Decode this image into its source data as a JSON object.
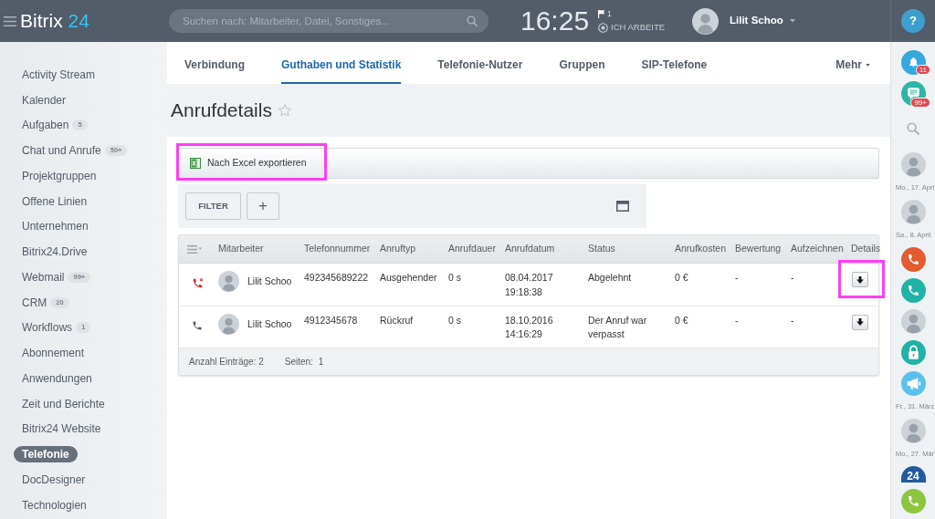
{
  "header": {
    "logo": {
      "name": "Bitrix",
      "number": "24"
    },
    "search": {
      "placeholder": "Suchen nach: Mitarbeiter, Datei, Sonstiges..."
    },
    "clock": "16:25",
    "flag_count": "1",
    "work_status": "ICH ARBEITE",
    "user": {
      "name": "Lilit Schoo"
    }
  },
  "sidebar": {
    "items": [
      {
        "label": "Activity Stream",
        "selected": false
      },
      {
        "label": "Kalender",
        "selected": false
      },
      {
        "label": "Aufgaben",
        "counter": "5",
        "selected": false
      },
      {
        "label": "Chat und Anrufe",
        "counter": "50+",
        "selected": false
      },
      {
        "label": "Projektgruppen",
        "selected": false
      },
      {
        "label": "Offene Linien",
        "selected": false
      },
      {
        "label": "Unternehmen",
        "selected": false
      },
      {
        "label": "Bitrix24.Drive",
        "selected": false
      },
      {
        "label": "Webmail",
        "counter": "99+",
        "selected": false
      },
      {
        "label": "CRM",
        "counter": "20",
        "selected": false
      },
      {
        "label": "Workflows",
        "counter": "1",
        "selected": false
      },
      {
        "label": "Abonnement",
        "selected": false
      },
      {
        "label": "Anwendungen",
        "selected": false
      },
      {
        "label": "Zeit und Berichte",
        "selected": false
      },
      {
        "label": "Bitrix24 Website",
        "selected": false
      },
      {
        "label": "Telefonie",
        "selected": true
      },
      {
        "label": "DocDesigner",
        "selected": false
      },
      {
        "label": "Technologien",
        "selected": false
      }
    ]
  },
  "tab_bar": {
    "tabs": [
      {
        "label": "Verbindung",
        "selected": false
      },
      {
        "label": "Guthaben und Statistik",
        "selected": true
      },
      {
        "label": "Telefonie-Nutzer",
        "selected": false
      },
      {
        "label": "Gruppen",
        "selected": false
      },
      {
        "label": "SIP-Telefone",
        "selected": false
      }
    ],
    "more": "Mehr"
  },
  "page_title": "Anrufdetails",
  "export_button": {
    "label": "Nach Excel exportieren",
    "highlighted": true
  },
  "filter_bar": {
    "filter_button": "FILTER",
    "add_button": "+"
  },
  "table": {
    "columns": [
      "Mitarbeiter",
      "Telefonnummer",
      "Anruftyp",
      "Anrufdauer",
      "Anrufdatum",
      "Status",
      "Anrufkosten",
      "Bewertung",
      "Aufzeichnen",
      "Details"
    ],
    "rows": [
      {
        "kind": "declined",
        "employee": "Lilit Schoo",
        "phone": "492345689222",
        "call_type": "Ausgehender",
        "duration": "0 s",
        "date": "08.04.2017",
        "time": "19:18:38",
        "status": "Abgelehnt",
        "cost": "0 €",
        "rating": "-",
        "recording": "-",
        "details_highlighted": true
      },
      {
        "kind": "regular",
        "employee": "Lilit Schoo",
        "phone": "4912345678",
        "call_type": "Rückruf",
        "duration": "0 s",
        "date": "18.10.2016",
        "time": "14:16:29",
        "status": "Der Anruf war verpasst",
        "cost": "0 €",
        "rating": "-",
        "recording": "-",
        "details_highlighted": false
      }
    ],
    "footer": {
      "count": "Anzahl Einträge: 2",
      "pages_label": "Seiten:",
      "pages": "1"
    }
  },
  "right_bar": {
    "help": "?",
    "items": [
      {
        "kind": "notifications",
        "badge": "11",
        "color": "#35a9df"
      },
      {
        "kind": "chat",
        "badge": "99+",
        "color": "#2db5a5"
      },
      {
        "kind": "search"
      },
      {
        "kind": "avatar"
      },
      {
        "kind": "date",
        "label": "Mo., 17. Apri"
      },
      {
        "kind": "avatar"
      },
      {
        "kind": "date",
        "label": "Sa., 8. April"
      },
      {
        "kind": "call",
        "color": "#e35b2f"
      },
      {
        "kind": "call",
        "color": "#1fb3a6"
      },
      {
        "kind": "avatar"
      },
      {
        "kind": "lock",
        "color": "#1fb3a6"
      },
      {
        "kind": "megaphone",
        "color": "#5cc1ea"
      },
      {
        "kind": "date",
        "label": "Fr., 31. März"
      },
      {
        "kind": "avatar"
      },
      {
        "kind": "date",
        "label": "Mo., 27. Mär"
      },
      {
        "kind": "app",
        "label": "24",
        "color": "#22599f"
      }
    ]
  }
}
